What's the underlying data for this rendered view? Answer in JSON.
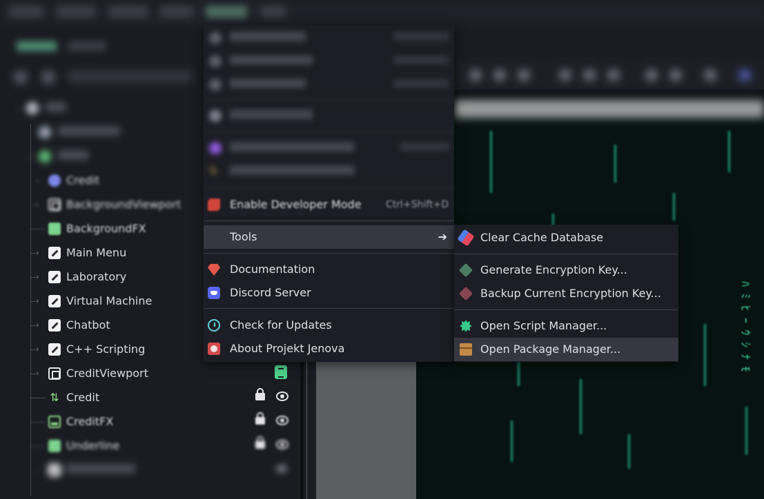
{
  "tree": {
    "rows": [
      {
        "label": "Credit",
        "icon": "credit-icon"
      },
      {
        "label": "BackgroundViewport",
        "icon": "viewport-icon"
      },
      {
        "label": "BackgroundFX",
        "icon": "color-rect-icon"
      },
      {
        "label": "Main Menu",
        "icon": "pencil-icon"
      },
      {
        "label": "Laboratory",
        "icon": "pencil-icon"
      },
      {
        "label": "Virtual Machine",
        "icon": "pencil-icon"
      },
      {
        "label": "Chatbot",
        "icon": "pencil-icon"
      },
      {
        "label": "C++ Scripting",
        "icon": "pencil-icon"
      },
      {
        "label": "CreditViewport",
        "icon": "viewport-icon"
      },
      {
        "label": "Credit",
        "icon": "credit-icon"
      },
      {
        "label": "CreditFX",
        "icon": "texture-icon"
      },
      {
        "label": "Underline",
        "icon": "texture-icon"
      }
    ]
  },
  "main_menu": {
    "dev_mode": {
      "label": "Enable Developer Mode",
      "shortcut": "Ctrl+Shift+D"
    },
    "tools": {
      "label": "Tools"
    },
    "documentation": {
      "label": "Documentation"
    },
    "discord": {
      "label": "Discord Server"
    },
    "updates": {
      "label": "Check for Updates"
    },
    "about": {
      "label": "About Projekt Jenova"
    }
  },
  "tools_menu": {
    "clear_cache": {
      "label": "Clear Cache Database"
    },
    "gen_key": {
      "label": "Generate Encryption Key..."
    },
    "backup_key": {
      "label": "Backup Current Encryption Key..."
    },
    "script_manager": {
      "label": "Open Script Manager..."
    },
    "package_manager": {
      "label": "Open Package Manager..."
    }
  },
  "colors": {
    "menu_bg": "#1d1e25",
    "highlight": "#363740",
    "accent_green": "#35c98a"
  }
}
